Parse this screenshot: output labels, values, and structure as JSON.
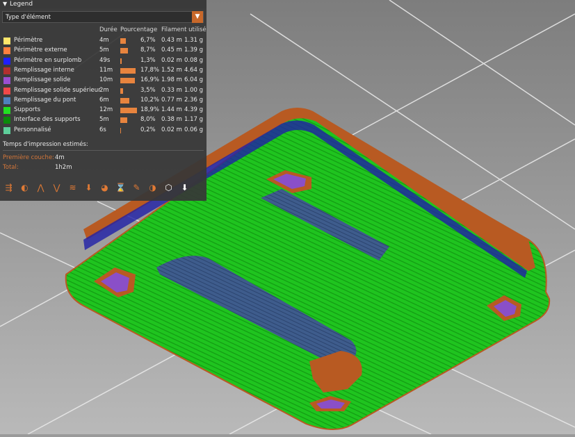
{
  "legend": {
    "title": "Legend",
    "dropdown_value": "Type d'élément",
    "columns": {
      "duration": "Durée",
      "percentage": "Pourcentage",
      "filament": "Filament utilisé"
    },
    "items": [
      {
        "label": "Périmètre",
        "color": "#ffe66b",
        "duration": "4m",
        "percent": "6,7%",
        "pct_value": 6.7,
        "length": "0.43 m",
        "weight": "1.31 g"
      },
      {
        "label": "Périmètre externe",
        "color": "#ff7f3f",
        "duration": "5m",
        "percent": "8,7%",
        "pct_value": 8.7,
        "length": "0.45 m",
        "weight": "1.39 g"
      },
      {
        "label": "Périmètre en surplomb",
        "color": "#1f1fff",
        "duration": "49s",
        "percent": "1,3%",
        "pct_value": 1.3,
        "length": "0.02 m",
        "weight": "0.08 g"
      },
      {
        "label": "Remplissage interne",
        "color": "#b23030",
        "duration": "11m",
        "percent": "17,8%",
        "pct_value": 17.8,
        "length": "1.52 m",
        "weight": "4.64 g"
      },
      {
        "label": "Remplissage solide",
        "color": "#9a4fd1",
        "duration": "10m",
        "percent": "16,9%",
        "pct_value": 16.9,
        "length": "1.98 m",
        "weight": "6.04 g"
      },
      {
        "label": "Remplissage solide supérieur",
        "color": "#f04848",
        "duration": "2m",
        "percent": "3,5%",
        "pct_value": 3.5,
        "length": "0.33 m",
        "weight": "1.00 g"
      },
      {
        "label": "Remplissage du pont",
        "color": "#4f81bd",
        "duration": "6m",
        "percent": "10,2%",
        "pct_value": 10.2,
        "length": "0.77 m",
        "weight": "2.36 g"
      },
      {
        "label": "Supports",
        "color": "#22e022",
        "duration": "12m",
        "percent": "18,9%",
        "pct_value": 18.9,
        "length": "1.44 m",
        "weight": "4.39 g"
      },
      {
        "label": "Interface des supports",
        "color": "#0b8a0b",
        "duration": "5m",
        "percent": "8,0%",
        "pct_value": 8.0,
        "length": "0.38 m",
        "weight": "1.17 g"
      },
      {
        "label": "Personnalisé",
        "color": "#5ecf9a",
        "duration": "6s",
        "percent": "0,2%",
        "pct_value": 0.2,
        "length": "0.02 m",
        "weight": "0.06 g"
      }
    ],
    "estimated_label": "Temps d'impression estimés:",
    "first_layer_label": "Première couche:",
    "first_layer_value": "4m",
    "total_label": "Total:",
    "total_value": "1h2m",
    "toolbar_icons": [
      "travel-icon",
      "wipe-icon",
      "retractions-icon",
      "deretractions-icon",
      "seams-icon",
      "tool-changes-icon",
      "color-changes-icon",
      "pause-icon",
      "custom-gcode-icon",
      "center-of-gravity-icon",
      "shells-icon",
      "tool-marker-icon"
    ]
  },
  "scene": {
    "background_top": "#7f7f7f",
    "background_bottom": "#b8b8b8",
    "support_color": "#1fc41f",
    "perimeter_color": "#b85a22",
    "bridge_color": "#3c5a8a",
    "solid_color": "#8a4fc8"
  }
}
